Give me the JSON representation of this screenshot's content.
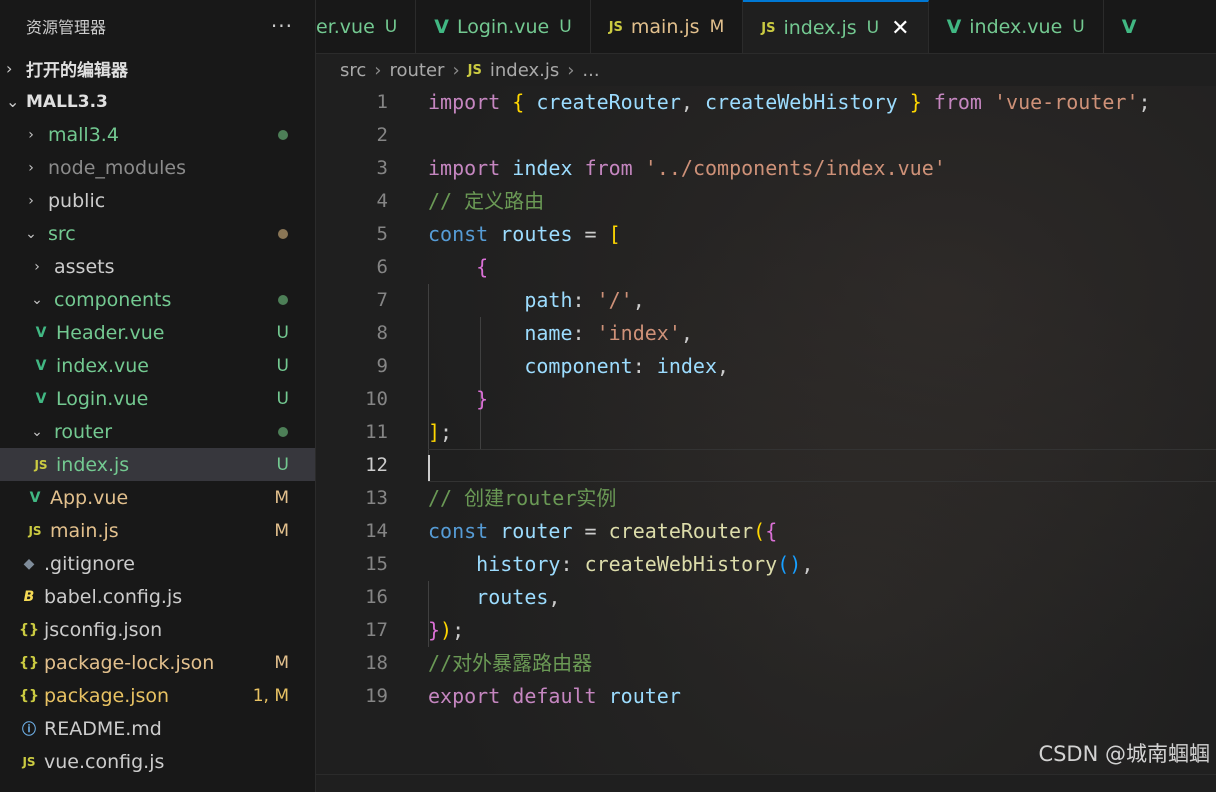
{
  "explorer": {
    "title": "资源管理器",
    "more": "···",
    "open_editors": "打开的编辑器",
    "project": "MALL3.3",
    "items": [
      {
        "label": "mall3.4",
        "kind": "folder",
        "depth": 1,
        "expanded": false,
        "color": "green",
        "deco": "dot-green"
      },
      {
        "label": "node_modules",
        "kind": "folder",
        "depth": 1,
        "expanded": false,
        "color": "grey",
        "deco": ""
      },
      {
        "label": "public",
        "kind": "folder",
        "depth": 1,
        "expanded": false,
        "color": "white",
        "deco": ""
      },
      {
        "label": "src",
        "kind": "folder",
        "depth": 1,
        "expanded": true,
        "color": "green",
        "deco": "dot-brown"
      },
      {
        "label": "assets",
        "kind": "folder",
        "depth": 2,
        "expanded": false,
        "color": "white",
        "deco": ""
      },
      {
        "label": "components",
        "kind": "folder",
        "depth": 2,
        "expanded": true,
        "color": "green",
        "deco": "dot-green"
      },
      {
        "label": "Header.vue",
        "kind": "vue",
        "depth": 3,
        "color": "green",
        "deco": "U"
      },
      {
        "label": "index.vue",
        "kind": "vue",
        "depth": 3,
        "color": "green",
        "deco": "U"
      },
      {
        "label": "Login.vue",
        "kind": "vue",
        "depth": 3,
        "color": "green",
        "deco": "U"
      },
      {
        "label": "router",
        "kind": "folder",
        "depth": 2,
        "expanded": true,
        "color": "green",
        "deco": "dot-green"
      },
      {
        "label": "index.js",
        "kind": "js",
        "depth": 3,
        "color": "green",
        "deco": "U",
        "selected": true
      },
      {
        "label": "App.vue",
        "kind": "vue",
        "depth": 2,
        "color": "orange",
        "deco": "M"
      },
      {
        "label": "main.js",
        "kind": "js",
        "depth": 2,
        "color": "orange",
        "deco": "M"
      },
      {
        "label": ".gitignore",
        "kind": "git",
        "depth": 1,
        "color": "white",
        "deco": ""
      },
      {
        "label": "babel.config.js",
        "kind": "babel",
        "depth": 1,
        "color": "white",
        "deco": ""
      },
      {
        "label": "jsconfig.json",
        "kind": "json",
        "depth": 1,
        "color": "white",
        "deco": ""
      },
      {
        "label": "package-lock.json",
        "kind": "json",
        "depth": 1,
        "color": "orange",
        "deco": "M"
      },
      {
        "label": "package.json",
        "kind": "json",
        "depth": 1,
        "color": "yellow",
        "deco": "1, M"
      },
      {
        "label": "README.md",
        "kind": "info",
        "depth": 1,
        "color": "white",
        "deco": ""
      },
      {
        "label": "vue.config.js",
        "kind": "js",
        "depth": 1,
        "color": "white",
        "deco": ""
      }
    ]
  },
  "tabs": [
    {
      "label": "er.vue",
      "icon": "",
      "mark": "U",
      "kind": "vue"
    },
    {
      "label": "Login.vue",
      "icon": "V",
      "mark": "U",
      "kind": "vue"
    },
    {
      "label": "main.js",
      "icon": "JS",
      "mark": "M",
      "kind": "js"
    },
    {
      "label": "index.js",
      "icon": "JS",
      "mark": "U",
      "kind": "js",
      "active": true
    },
    {
      "label": "index.vue",
      "icon": "V",
      "mark": "U",
      "kind": "vue"
    },
    {
      "label": "",
      "icon": "V",
      "mark": "",
      "kind": "vue"
    }
  ],
  "breadcrumb": {
    "parts": [
      "src",
      "router"
    ],
    "file": "index.js",
    "tail": "..."
  },
  "editor": {
    "current_line": 12,
    "lines": [
      [
        [
          "kw",
          "import"
        ],
        [
          "punc",
          " "
        ],
        [
          "br1",
          "{"
        ],
        [
          "punc",
          " "
        ],
        [
          "var",
          "createRouter"
        ],
        [
          "punc",
          ", "
        ],
        [
          "var",
          "createWebHistory"
        ],
        [
          "punc",
          " "
        ],
        [
          "br1",
          "}"
        ],
        [
          "punc",
          " "
        ],
        [
          "kw",
          "from"
        ],
        [
          "punc",
          " "
        ],
        [
          "str",
          "'vue-router'"
        ],
        [
          "punc",
          ";"
        ]
      ],
      [],
      [
        [
          "kw",
          "import"
        ],
        [
          "punc",
          " "
        ],
        [
          "var",
          "index"
        ],
        [
          "punc",
          " "
        ],
        [
          "kw",
          "from"
        ],
        [
          "punc",
          " "
        ],
        [
          "str",
          "'../components/index.vue'"
        ]
      ],
      [
        [
          "cmt",
          "// 定义路由"
        ]
      ],
      [
        [
          "kw2",
          "const"
        ],
        [
          "punc",
          " "
        ],
        [
          "var",
          "routes"
        ],
        [
          "punc",
          " = "
        ],
        [
          "br1",
          "["
        ]
      ],
      [
        [
          "punc",
          "    "
        ],
        [
          "br2",
          "{"
        ]
      ],
      [
        [
          "punc",
          "        "
        ],
        [
          "prop",
          "path"
        ],
        [
          "punc",
          ": "
        ],
        [
          "str",
          "'/'"
        ],
        [
          "punc",
          ","
        ]
      ],
      [
        [
          "punc",
          "        "
        ],
        [
          "prop",
          "name"
        ],
        [
          "punc",
          ": "
        ],
        [
          "str",
          "'index'"
        ],
        [
          "punc",
          ","
        ]
      ],
      [
        [
          "punc",
          "        "
        ],
        [
          "prop",
          "component"
        ],
        [
          "punc",
          ": "
        ],
        [
          "var",
          "index"
        ],
        [
          "punc",
          ","
        ]
      ],
      [
        [
          "punc",
          "    "
        ],
        [
          "br2",
          "}"
        ]
      ],
      [
        [
          "br1",
          "]"
        ],
        [
          "punc",
          ";"
        ]
      ],
      [],
      [
        [
          "cmt",
          "// 创建router实例"
        ]
      ],
      [
        [
          "kw2",
          "const"
        ],
        [
          "punc",
          " "
        ],
        [
          "var",
          "router"
        ],
        [
          "punc",
          " = "
        ],
        [
          "fn",
          "createRouter"
        ],
        [
          "br1",
          "("
        ],
        [
          "br2",
          "{"
        ]
      ],
      [
        [
          "punc",
          "    "
        ],
        [
          "prop",
          "history"
        ],
        [
          "punc",
          ": "
        ],
        [
          "fn",
          "createWebHistory"
        ],
        [
          "br3",
          "()"
        ],
        [
          "punc",
          ","
        ]
      ],
      [
        [
          "punc",
          "    "
        ],
        [
          "var",
          "routes"
        ],
        [
          "punc",
          ","
        ]
      ],
      [
        [
          "br2",
          "}"
        ],
        [
          "br1",
          ")"
        ],
        [
          "punc",
          ";"
        ]
      ],
      [
        [
          "cmt",
          "//对外暴露路由器"
        ]
      ],
      [
        [
          "kw",
          "export"
        ],
        [
          "punc",
          " "
        ],
        [
          "kw",
          "default"
        ],
        [
          "punc",
          " "
        ],
        [
          "var",
          "router"
        ]
      ]
    ]
  },
  "watermark": "CSDN @城南蝈蝈"
}
